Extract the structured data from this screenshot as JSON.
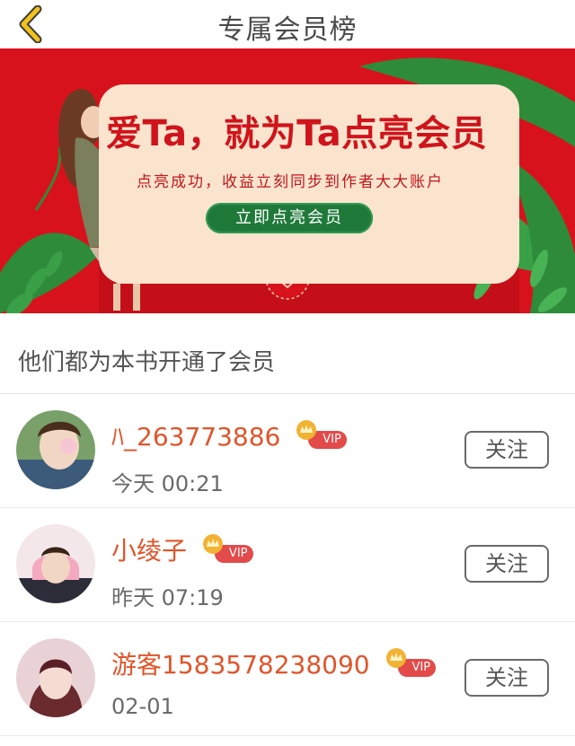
{
  "header": {
    "title": "专属会员榜",
    "back_icon": "chevron-left-icon"
  },
  "banner": {
    "headline": "爱Ta，就为Ta点亮会员",
    "subline": "点亮成功，收益立刻同步到作者大大账户",
    "cta_label": "立即点亮会员",
    "colors": {
      "background": "#d8121c",
      "card": "#fbe4ce",
      "button": "#1f7a3a",
      "leaf": "#2e8b3a"
    }
  },
  "section": {
    "title": "他们都为本书开通了会员"
  },
  "members": [
    {
      "name": "ﾊ_263773886",
      "vip_label": "VIP",
      "time": "今天 00:21",
      "follow_label": "关注"
    },
    {
      "name": "小绫子",
      "vip_label": "VIP",
      "time": "昨天 07:19",
      "follow_label": "关注"
    },
    {
      "name": "游客1583578238090",
      "vip_label": "VIP",
      "time": "02-01",
      "follow_label": "关注"
    }
  ],
  "colors": {
    "name": "#e0552b",
    "vip_badge": "#e34a4a",
    "crown": "#f2b233"
  }
}
